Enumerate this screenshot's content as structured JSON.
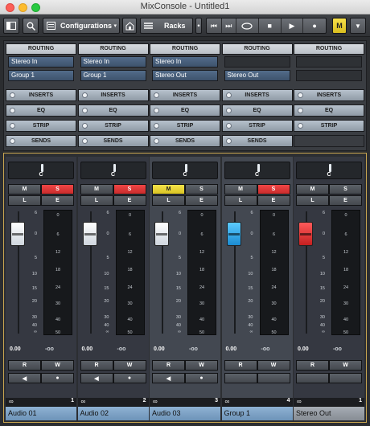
{
  "window": {
    "title": "MixConsole - Untitled1"
  },
  "toolbar": {
    "configurations_label": "Configurations",
    "racks_label": "Racks",
    "m_label": "M"
  },
  "rack": {
    "columns": [
      {
        "routing": "ROUTING",
        "input": "Stereo In",
        "output": "Group 1"
      },
      {
        "routing": "ROUTING",
        "input": "Stereo In",
        "output": "Group 1"
      },
      {
        "routing": "ROUTING",
        "input": "Stereo In",
        "output": "Stereo Out"
      },
      {
        "routing": "ROUTING",
        "input": "",
        "output": "Stereo Out"
      },
      {
        "routing": "ROUTING",
        "input": "",
        "output": ""
      }
    ],
    "sections": {
      "inserts": "INSERTS",
      "eq": "EQ",
      "strip": "STRIP",
      "sends": "SENDS"
    }
  },
  "scale_labels": [
    "6",
    "0",
    "5",
    "10",
    "15",
    "20",
    "30",
    "40",
    "∞"
  ],
  "meter_labels": [
    "0",
    "6",
    "12",
    "18",
    "24",
    "30",
    "40",
    "50"
  ],
  "buttons": {
    "m": "M",
    "s": "S",
    "l": "L",
    "e": "E",
    "r": "R",
    "w": "W"
  },
  "channels": [
    {
      "name": "Audio 01",
      "number": "1",
      "pan": "C",
      "volume": "0.00",
      "peak": "-oo",
      "mute": false,
      "solo": true,
      "fader": "white"
    },
    {
      "name": "Audio 02",
      "number": "2",
      "pan": "C",
      "volume": "0.00",
      "peak": "-oo",
      "mute": false,
      "solo": true,
      "fader": "white"
    },
    {
      "name": "Audio 03",
      "number": "3",
      "pan": "C",
      "volume": "0.00",
      "peak": "-oo",
      "mute": true,
      "solo": false,
      "fader": "white"
    },
    {
      "name": "Group 1",
      "number": "4",
      "pan": "C",
      "volume": "0.00",
      "peak": "-oo",
      "mute": false,
      "solo": true,
      "fader": "blue"
    },
    {
      "name": "Stereo Out",
      "number": "1",
      "pan": "C",
      "volume": "0.00",
      "peak": "-oo",
      "mute": false,
      "solo": false,
      "fader": "red"
    }
  ],
  "colors": {
    "accent_selected_strip": "#434851",
    "solo": "#e03a3a",
    "mute_active": "#e8d434",
    "frame": "#c8a550"
  }
}
